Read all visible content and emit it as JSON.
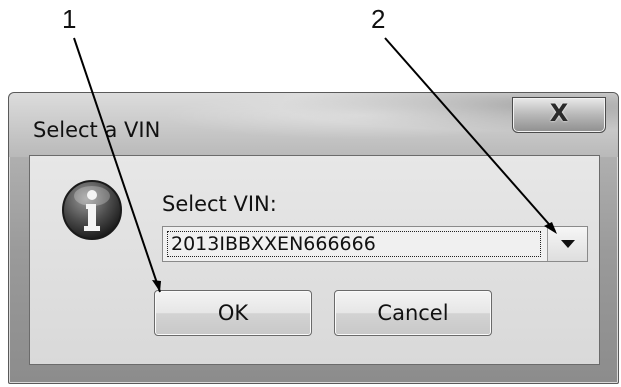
{
  "callouts": {
    "one": "1",
    "two": "2"
  },
  "dialog": {
    "title": "Select a VIN",
    "close_label": "X",
    "prompt": "Select VIN:",
    "vin_selected": "2013IBBXXEN666666",
    "ok_label": "OK",
    "cancel_label": "Cancel"
  },
  "icons": {
    "info": "information-icon",
    "dropdown": "chevron-down-icon",
    "close": "close-icon"
  }
}
